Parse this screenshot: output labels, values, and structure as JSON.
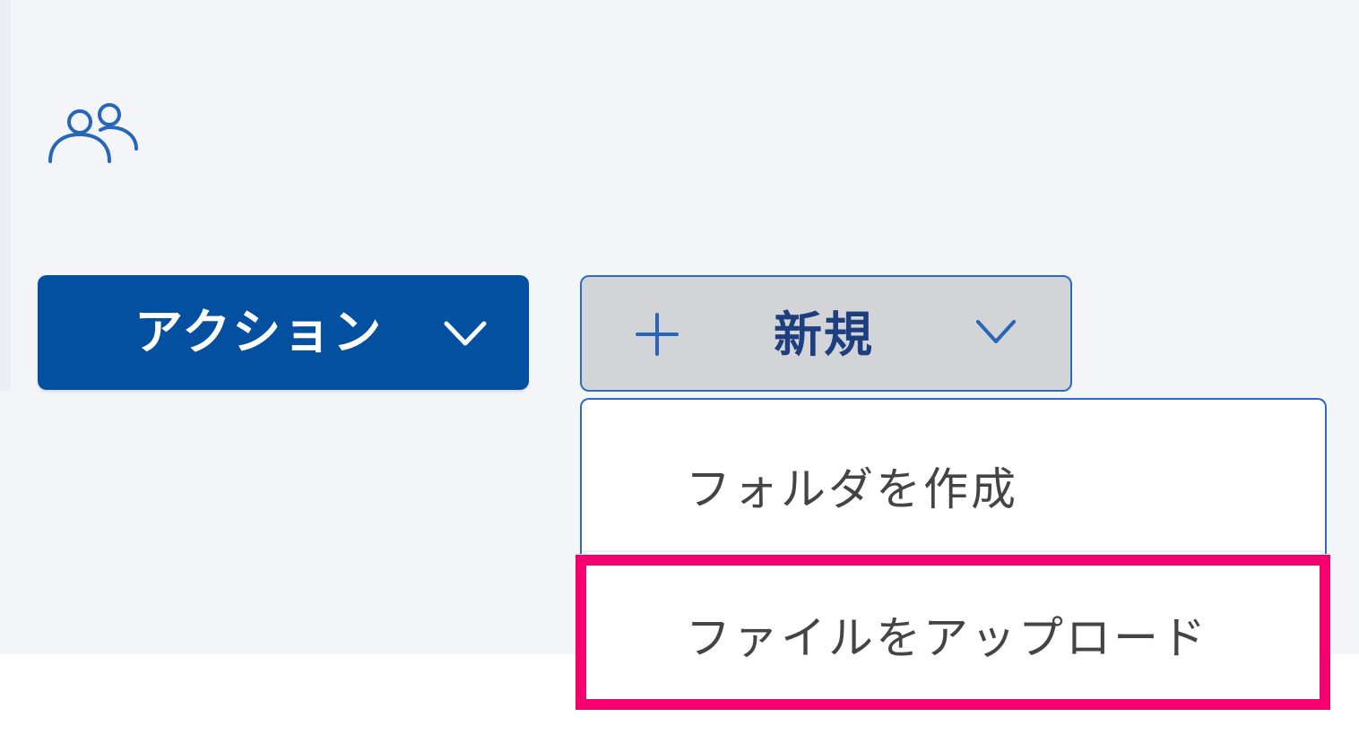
{
  "header": {
    "users_icon": "users-icon"
  },
  "toolbar": {
    "action_button": {
      "label": "アクション",
      "icon": "chevron-down-icon",
      "color": "#0450a0"
    },
    "new_button": {
      "label": "新規",
      "leading_icon": "plus-icon",
      "trailing_icon": "chevron-down-icon",
      "state": "expanded"
    }
  },
  "new_menu": {
    "items": [
      {
        "label": "フォルダを作成"
      },
      {
        "label": "ファイルをアップロード",
        "highlighted": true
      }
    ],
    "highlight_color": "#f5006e"
  }
}
